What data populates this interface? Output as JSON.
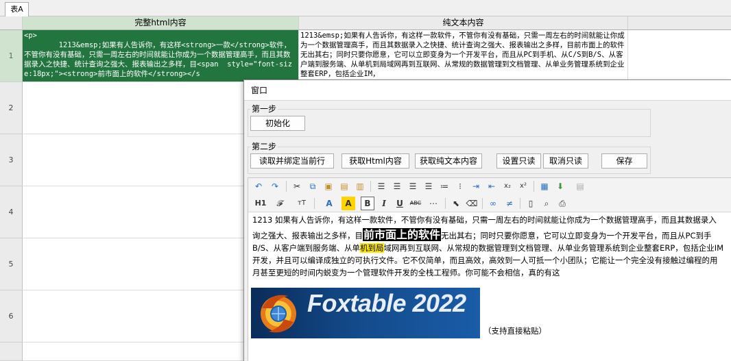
{
  "sheet": {
    "tab_label": "表A"
  },
  "grid": {
    "columns": [
      "完整html内容",
      "纯文本内容"
    ],
    "row_numbers": [
      "1",
      "2",
      "3",
      "4",
      "5",
      "6"
    ],
    "row1": {
      "html": "<p>\n        1213&emsp;如果有人告诉你，有这样<strong>一款</strong>软件，不管你有没有基础，只需一周左右的时间就能让你成为一个数据管理高手，而且其数据录入之快捷、统计查询之强大、报表输出之多样，目<span  style=\"font-size:18px;\"><strong>前市面上的软件</strong></s",
      "text": "1213&emsp;如果有人告诉你，有这样一款软件，不管你有没有基础，只需一周左右的时间就能让你成为一个数据管理高手，而且其数据录入之快捷、统计查询之强大、报表输出之多样，目前市面上的软件无出其右；同时只要你愿意，它可以立即变身为一个开发平台，而且从PC到手机、从C/S到B/S、从客户端到服务端、从单机到局域网再到互联网、从常规的数据管理到文档管理、从单业务管理系统到企业整套ERP，包括企业IM，"
    }
  },
  "window": {
    "title": "窗口",
    "step1": {
      "label": "第一步",
      "init_button": "初始化"
    },
    "step2": {
      "label": "第二步",
      "read_bind_button": "读取并绑定当前行",
      "get_html_button": "获取Html内容",
      "get_text_button": "获取纯文本内容",
      "set_readonly_button": "设置只读",
      "cancel_readonly_button": "取消只读",
      "save_button": "保存"
    },
    "editor": {
      "toolbar": {
        "heading": "H1",
        "subscript": "x₂",
        "superscript": "x²",
        "bold": "B",
        "italic": "I",
        "underline": "U",
        "strikethrough": "ABC"
      },
      "content": {
        "line1": "1213   如果有人告诉你，有这样一款软件，不管你有没有基础，只需一周左右的时间就能让你成为一个数据管理高手，而且其数据录入",
        "line2_a": "询之强大、报表输出之多样，目",
        "line2_big": "前市面上的软件",
        "line2_b": "无出其右；同时只要你愿意，它可以立即变身为一个开发平台，而且从PC到手",
        "line3_a": "B/S、从客户端到服务端、从单",
        "line3_hl": "机到局",
        "line3_b": "域网再到互联网、从常规的数据管理到文档管理、从单业务管理系统到企业整套ERP，包括企业IM",
        "line4": "开发，并且可以编译成独立的可执行文件。它不仅简单，而且高效，高效到一人可抵一个小团队；它能让一个完全没有接触过编程的用",
        "line5": "月甚至更短的时间内蜕变为一个管理软件开发的全栈工程师。你可能不会相信，真的有这",
        "logo_text": "Foxtable 2022",
        "caption": "（支持直接粘贴）"
      }
    }
  },
  "colors": {
    "selected_cell": "#22753f",
    "selected_header": "#cfe3cf",
    "highlight": "#ffe800"
  }
}
